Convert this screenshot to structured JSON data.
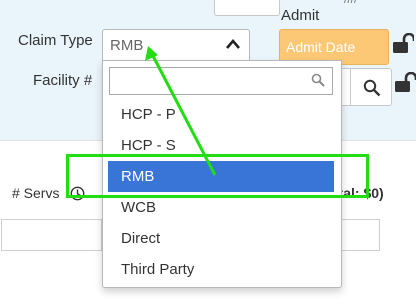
{
  "form": {
    "admit_label": "Admit",
    "admit_date_placeholder": "Admit Date",
    "claim_type_label": "Claim Type",
    "claim_type_value": "RMB",
    "facility_label": "Facility #",
    "top_cut_text": "////"
  },
  "dropdown": {
    "search_value": "",
    "options": [
      "HCP - P",
      "HCP - S",
      "RMB",
      "WCB",
      "Direct",
      "Third Party"
    ],
    "selected": "RMB"
  },
  "services": {
    "count_label": "# Servs",
    "total_label": "otal: $0)"
  },
  "colors": {
    "top_panel_bg": "#eaf4fb",
    "admit_date_bg": "#fcc875",
    "selected_option_bg": "#3875d7",
    "annotation_green": "#22dd11"
  },
  "icons": {
    "claim_type_toggle": "chevron-up-icon",
    "admit_lock": "lock-open-icon",
    "facility_lock": "lock-open-icon",
    "facility_search": "search-icon",
    "dropdown_search": "search-icon",
    "servs_info": "clock-icon"
  }
}
